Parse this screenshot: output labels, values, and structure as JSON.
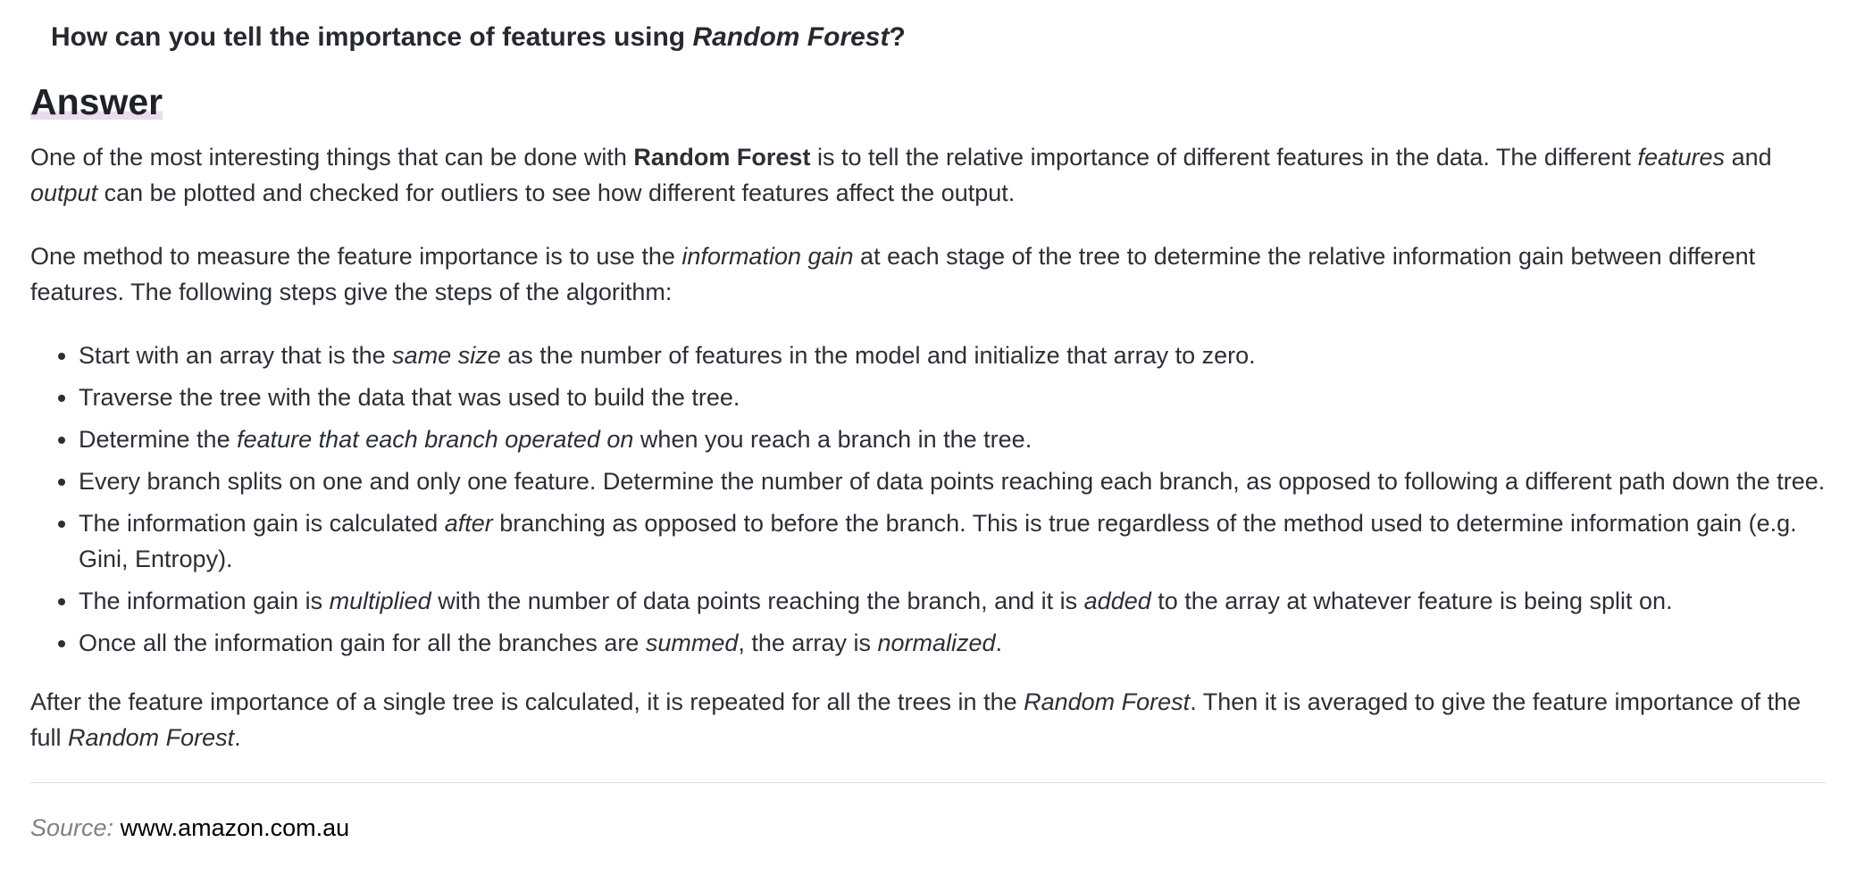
{
  "question": {
    "prefix": "How can you tell the importance of features using ",
    "emphasis": "Random Forest",
    "suffix": "?"
  },
  "answer_heading": "Answer",
  "paragraph1": {
    "t1": "One of the most interesting things that can be done with ",
    "b1": "Random Forest",
    "t2": " is to tell the relative importance of different features in the data. The different ",
    "i1": "features",
    "t3": " and ",
    "i2": "output",
    "t4": " can be plotted and checked for outliers to see how different features affect the output."
  },
  "paragraph2": {
    "t1": "One method to measure the feature importance is to use the ",
    "i1": "information gain",
    "t2": " at each stage of the tree to determine the relative information gain between different features. The following steps give the steps of the algorithm:"
  },
  "steps": [
    {
      "t1": "Start with an array that is the ",
      "i1": "same size",
      "t2": " as the number of features in the model and initialize that array to zero."
    },
    {
      "t1": "Traverse the tree with the data that was used to build the tree."
    },
    {
      "t1": "Determine the ",
      "i1": "feature that each branch operated on",
      "t2": " when you reach a branch in the tree."
    },
    {
      "t1": "Every branch splits on one and only one feature. Determine the number of data points reaching each branch, as opposed to following a different path down the tree."
    },
    {
      "t1": "The information gain is calculated ",
      "i1": "after",
      "t2": " branching as opposed to before the branch. This is true regardless of the method used to determine information gain (e.g. Gini, Entropy)."
    },
    {
      "t1": "The information gain is ",
      "i1": "multiplied",
      "t2": " with the number of data points reaching the branch, and it is ",
      "i2": "added",
      "t3": " to the array at whatever feature is being split on."
    },
    {
      "t1": "Once all the information gain for all the branches are ",
      "i1": "summed",
      "t2": ", the array is ",
      "i2": "normalized",
      "t3": "."
    }
  ],
  "paragraph3": {
    "t1": "After the feature importance of a single tree is calculated, it is repeated for all the trees in the ",
    "i1": "Random Forest",
    "t2": ". Then it is averaged to give the feature importance of the full ",
    "i2": "Random Forest",
    "t3": "."
  },
  "source": {
    "label": "Source:",
    "value": "www.amazon.com.au"
  }
}
